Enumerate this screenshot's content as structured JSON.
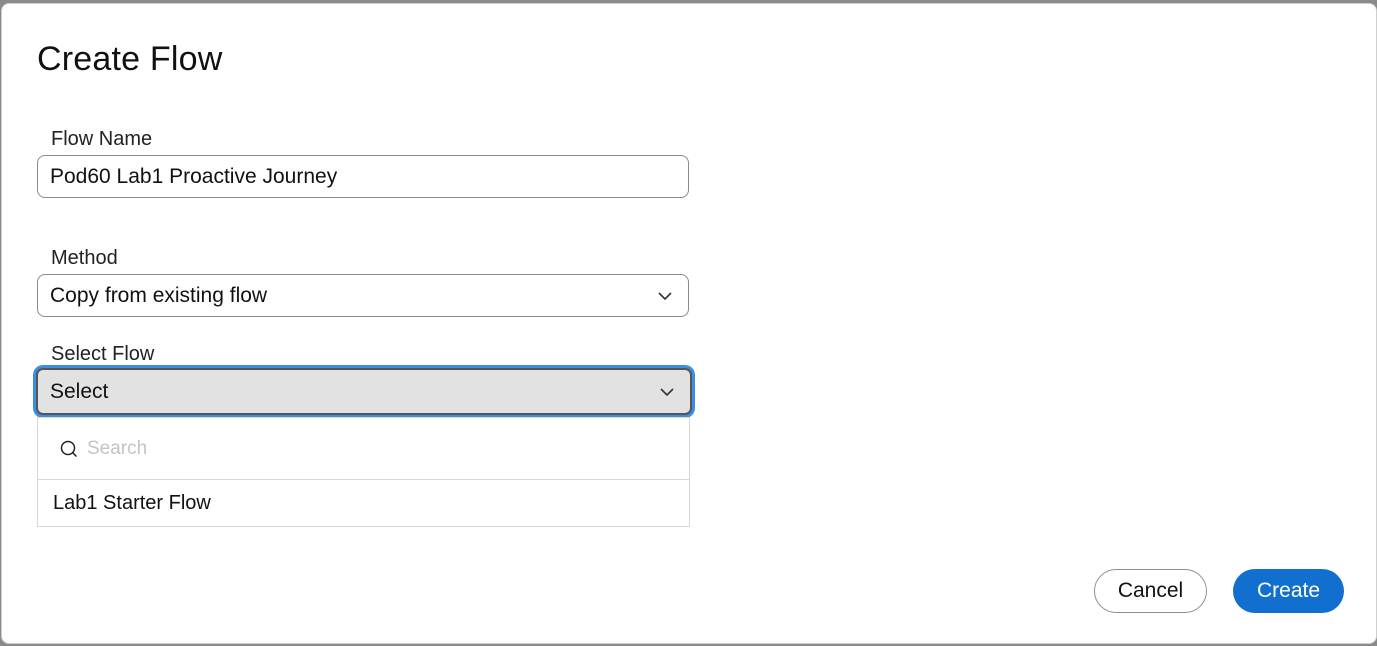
{
  "dialog": {
    "title": "Create Flow",
    "flow_name": {
      "label": "Flow Name",
      "value": "Pod60 Lab1 Proactive Journey"
    },
    "method": {
      "label": "Method",
      "selected": "Copy from existing flow"
    },
    "select_flow": {
      "label": "Select Flow",
      "selected": "Select",
      "search_placeholder": "Search",
      "options": [
        "Lab1 Starter Flow"
      ]
    },
    "buttons": {
      "cancel": "Cancel",
      "create": "Create"
    }
  },
  "colors": {
    "primary": "#1170cf",
    "focus_ring": "#3a8ee6"
  }
}
